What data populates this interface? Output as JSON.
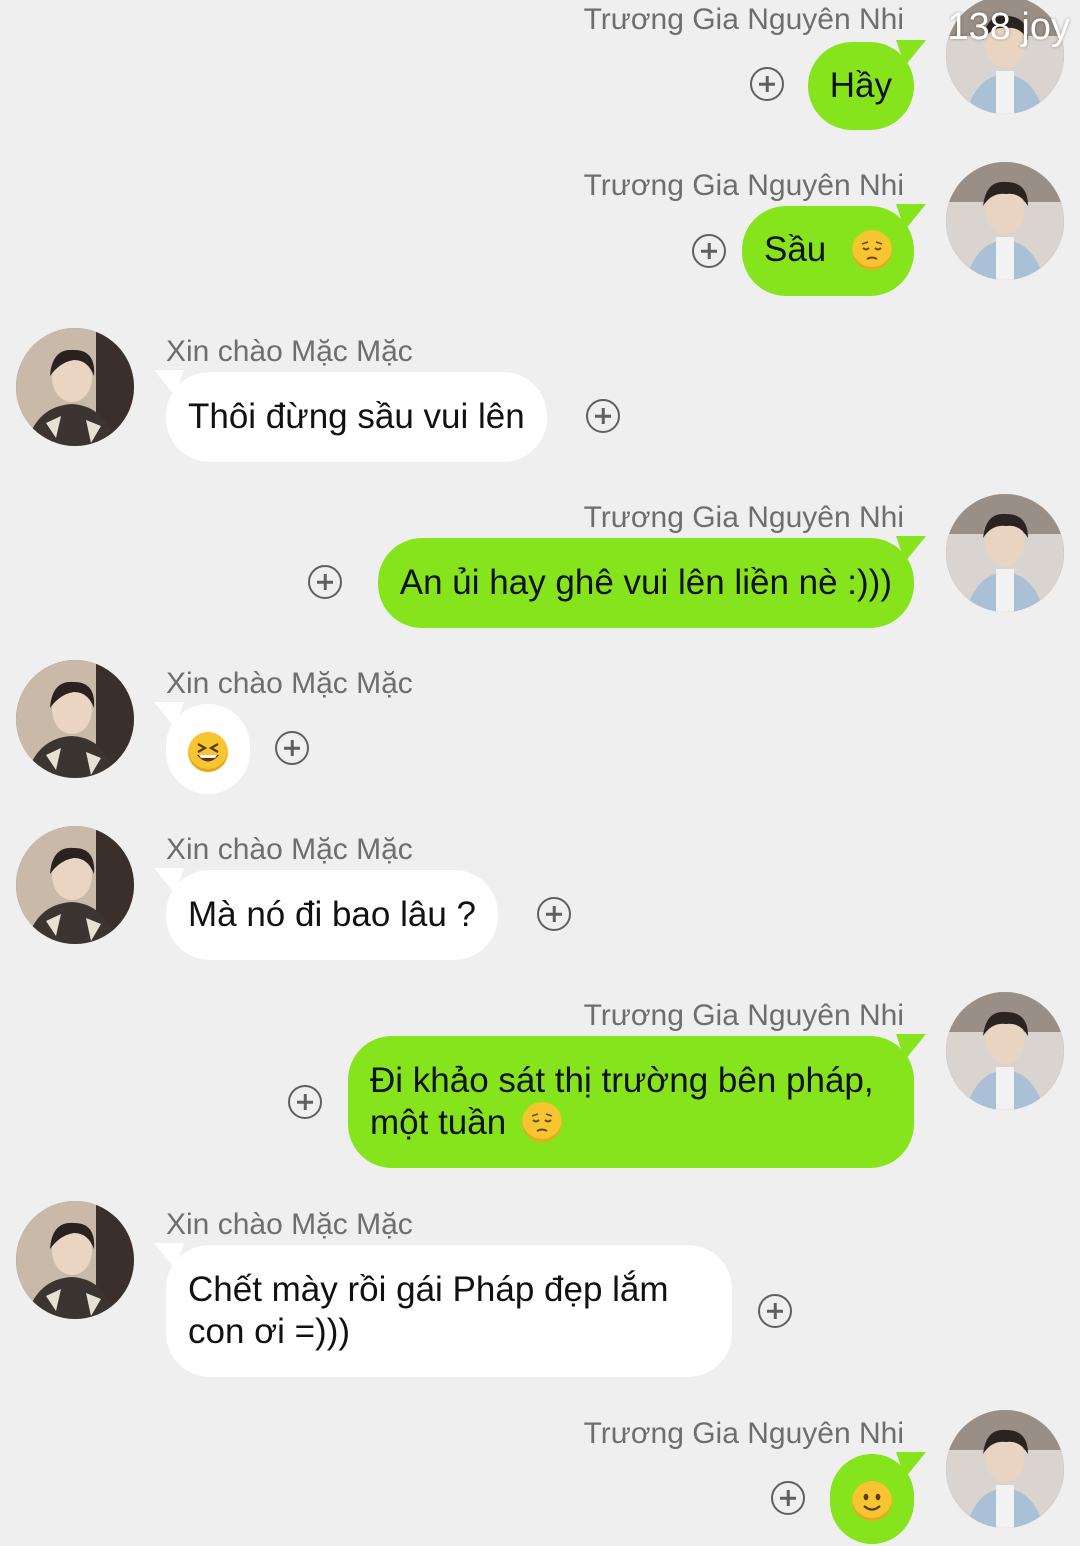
{
  "watermark": "138 joy",
  "contacts": {
    "me": "Trương Gia Nguyên Nhi",
    "friend": "Xin chào Mặc Mặc"
  },
  "messages": [
    {
      "side": "out",
      "sender": "Trương Gia Nguyên Nhi",
      "text": "Hầy"
    },
    {
      "side": "out",
      "sender": "Trương Gia Nguyên Nhi",
      "text": "Sầu",
      "emoji": "pensive-face"
    },
    {
      "side": "in",
      "sender": "Xin chào Mặc Mặc",
      "text": "Thôi đừng sầu vui lên"
    },
    {
      "side": "out",
      "sender": "Trương Gia Nguyên Nhi",
      "text": "An ủi hay ghê vui lên liền nè :)))"
    },
    {
      "side": "in",
      "sender": "Xin chào Mặc Mặc",
      "text": "",
      "emoji": "grinning-squinting-face"
    },
    {
      "side": "in",
      "sender": "Xin chào Mặc Mặc",
      "text": "Mà nó đi bao lâu ?"
    },
    {
      "side": "out",
      "sender": "Trương Gia Nguyên Nhi",
      "text": "Đi khảo sát thị trường bên pháp,",
      "text2": "một tuần",
      "emoji": "pensive-face"
    },
    {
      "side": "in",
      "sender": "Xin chào Mặc Mặc",
      "text": "Chết mày rồi gái Pháp đẹp lắm",
      "text2": "con ơi =)))"
    },
    {
      "side": "out",
      "sender": "Trương Gia Nguyên Nhi",
      "text": "",
      "emoji": "slightly-smiling-face"
    }
  ],
  "colors": {
    "background": "#efefef",
    "outgoing_bubble": "#86e41c",
    "incoming_bubble": "#ffffff",
    "name_text": "#6e6e6e"
  },
  "icons": {
    "add": "plus-circle-icon",
    "avatar": "profile-photo"
  }
}
